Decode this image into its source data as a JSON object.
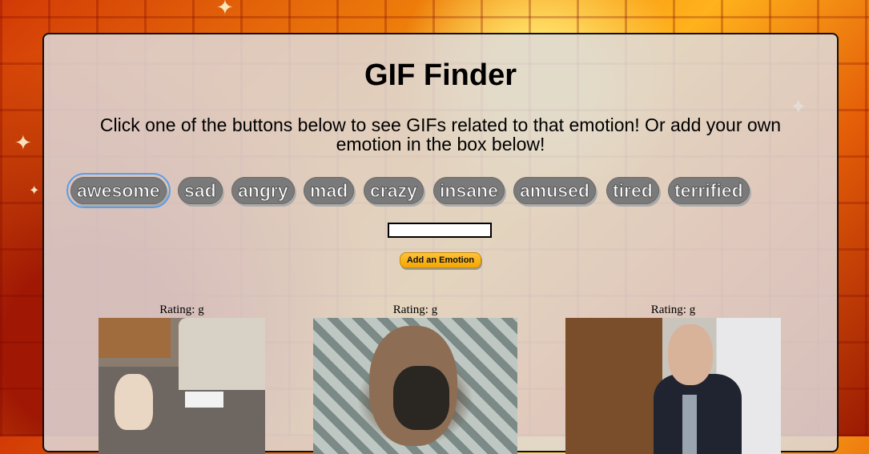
{
  "page": {
    "title": "GIF Finder",
    "instructions": "Click one of the buttons below to see GIFs related to that emotion! Or add your own emotion in the box below!"
  },
  "emotions": [
    "awesome",
    "sad",
    "angry",
    "mad",
    "crazy",
    "insane",
    "amused",
    "tired",
    "terrified"
  ],
  "form": {
    "input_value": "",
    "add_button_label": "Add an Emotion"
  },
  "results": [
    {
      "rating": "Rating: g"
    },
    {
      "rating": "Rating: g"
    },
    {
      "rating": "Rating: g"
    }
  ],
  "colors": {
    "button_bg": "#7a7a7a",
    "add_button": "#f5a600",
    "focus_ring": "#5a9ee8"
  }
}
